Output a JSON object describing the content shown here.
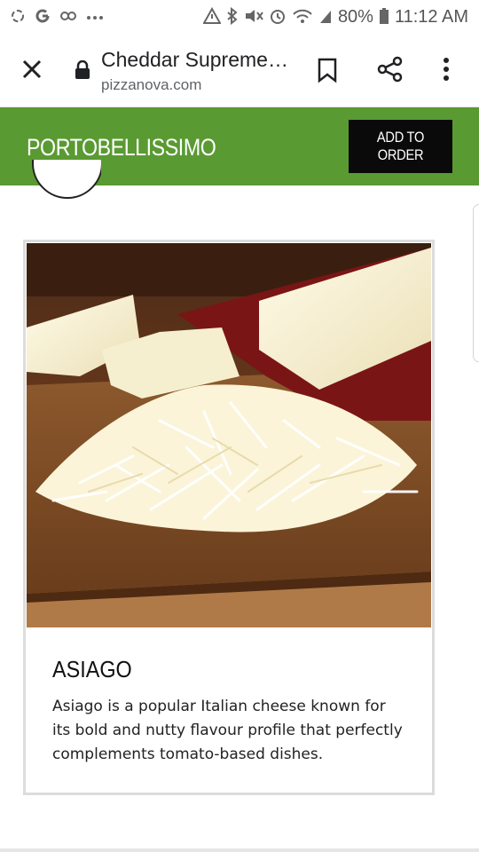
{
  "status_bar": {
    "battery_percent": "80%",
    "time": "11:12 AM",
    "icons": [
      "recycle-icon",
      "google-icon",
      "link-icon",
      "more-dots-icon",
      "warning-icon",
      "bluetooth-icon",
      "mute-icon",
      "alarm-icon",
      "wifi-icon",
      "signal-icon",
      "battery-icon"
    ]
  },
  "browser": {
    "page_title": "Cheddar Supreme…",
    "url": "pizzanova.com",
    "icons": [
      "close-icon",
      "lock-icon",
      "bookmark-icon",
      "share-icon",
      "menu-dots-icon"
    ]
  },
  "header": {
    "brand": "PORTOBELLISSIMO",
    "order_button_label": "ADD TO ORDER",
    "background": "#5a9a32",
    "button_background": "#0a0a0a"
  },
  "card": {
    "title": "ASIAGO",
    "description": "Asiago is a popular Italian cheese known for its bold and nutty flavour profile that perfectly complements tomato-based dishes.",
    "image": "shredded-cheese-on-cutting-board"
  }
}
